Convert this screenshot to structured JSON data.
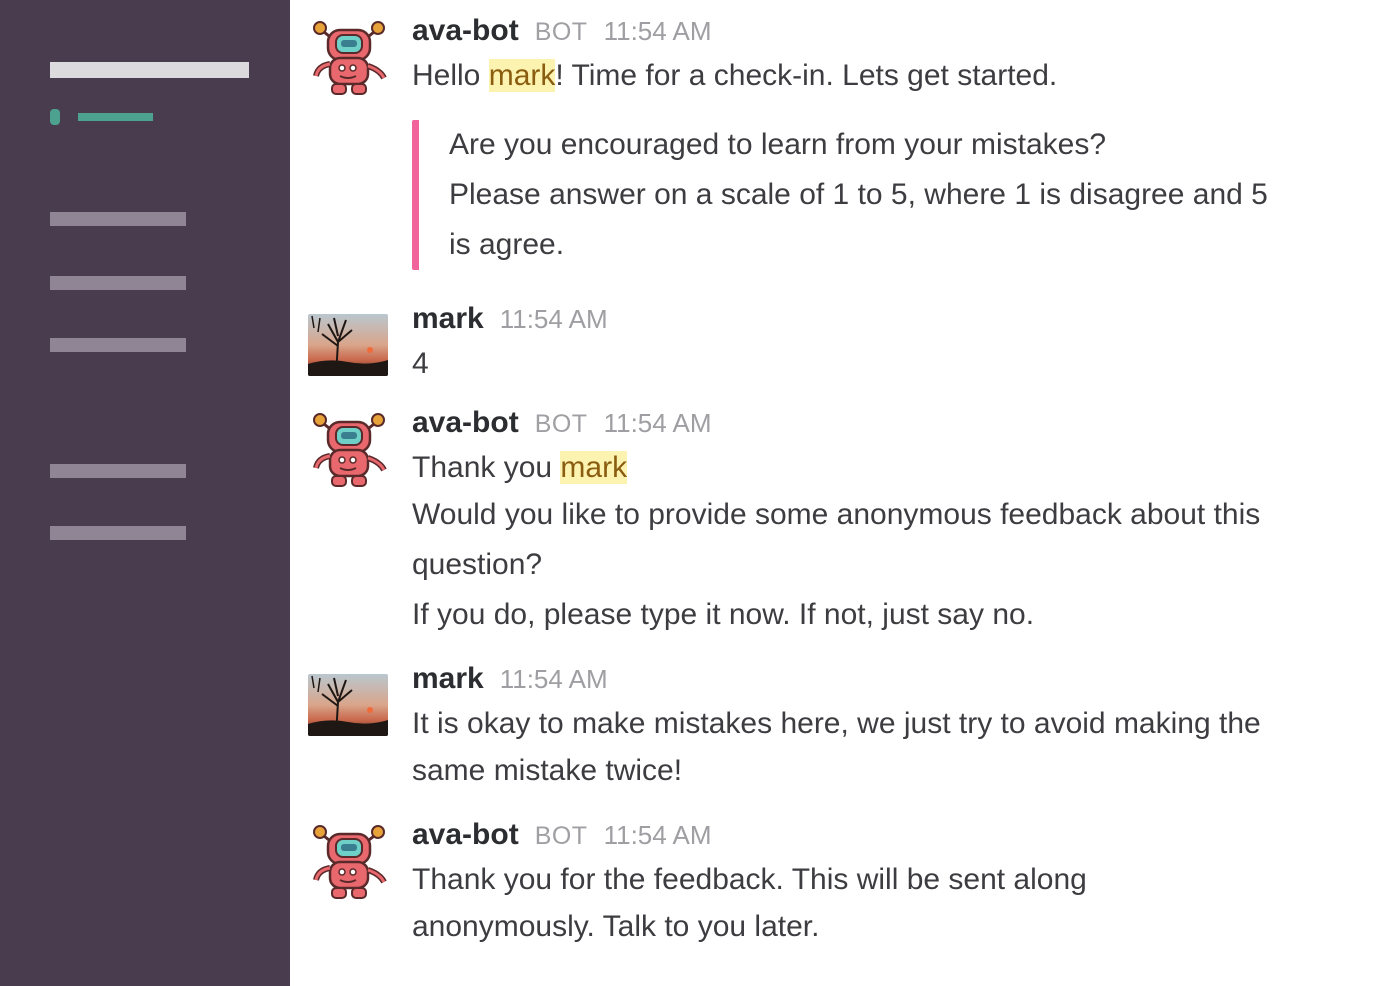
{
  "messages": [
    {
      "sender": "ava-bot",
      "badge": "BOT",
      "time": "11:54 AM",
      "greeting_pre": "Hello ",
      "mention": "mark",
      "greeting_post": "! Time for a check-in.  Lets get started.",
      "attachment": {
        "line1": "Are you encouraged to learn from your mistakes?",
        "line2": "Please answer on a scale of 1 to 5, where 1 is disagree and 5",
        "line3": "is agree.",
        "accent_color": "#f0639b"
      }
    },
    {
      "sender": "mark",
      "time": "11:54 AM",
      "text": "4"
    },
    {
      "sender": "ava-bot",
      "badge": "BOT",
      "time": "11:54 AM",
      "thanks_pre": "Thank you ",
      "mention": "mark",
      "line2": "Would you like to provide some anonymous feedback about this",
      "line3": "question?",
      "line4": "If you do, please type it now.  If not, just say no."
    },
    {
      "sender": "mark",
      "time": "11:54 AM",
      "line1": "It is okay to make mistakes here, we just try to avoid making the",
      "line2": "same mistake twice!"
    },
    {
      "sender": "ava-bot",
      "badge": "BOT",
      "time": "11:54 AM",
      "line1": "Thank you for the feedback. This will be sent along",
      "line2": "anonymously. Talk to you later."
    }
  ],
  "colors": {
    "sidebar_bg": "#4a3c4f",
    "mention_highlight": "#fdf3b0",
    "active_channel": "#4ca28e"
  },
  "icons": {
    "bot_avatar": "robot-avatar-icon",
    "user_avatar": "sunset-photo-avatar"
  }
}
